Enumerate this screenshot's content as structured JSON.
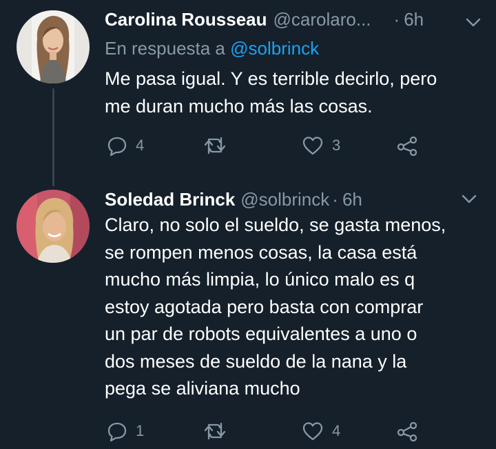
{
  "tweets": [
    {
      "name": "Carolina Rousseau",
      "handle": "@carolaro...",
      "dot": "·",
      "time": "6h",
      "reply_prefix": "En respuesta a",
      "reply_mention": "@solbrinck",
      "text_lines": [
        "Me pasa igual. Y es terrible decirlo, pero",
        "me duran mucho más las cosas."
      ],
      "replies": "4",
      "retweets": "",
      "likes": "3"
    },
    {
      "name": "Soledad Brinck",
      "handle": "@solbrinck",
      "dot": "·",
      "time": "6h",
      "text_lines": [
        "Claro, no solo el sueldo, se gasta menos,",
        "se rompen menos cosas, la casa está",
        "mucho más limpia, lo único malo es q",
        "estoy agotada pero basta con comprar",
        "un par de robots equivalentes a uno o",
        "dos meses de sueldo de la nana y la",
        "pega se aliviana mucho"
      ],
      "replies": "1",
      "retweets": "",
      "likes": "4"
    }
  ],
  "colors": {
    "background": "#15202b",
    "text": "#ffffff",
    "secondary": "#8899a6",
    "link": "#1da1f2",
    "thread_line": "#38444d"
  },
  "icons": [
    "reply-icon",
    "retweet-icon",
    "like-icon",
    "share-icon",
    "chevron-down-icon"
  ]
}
